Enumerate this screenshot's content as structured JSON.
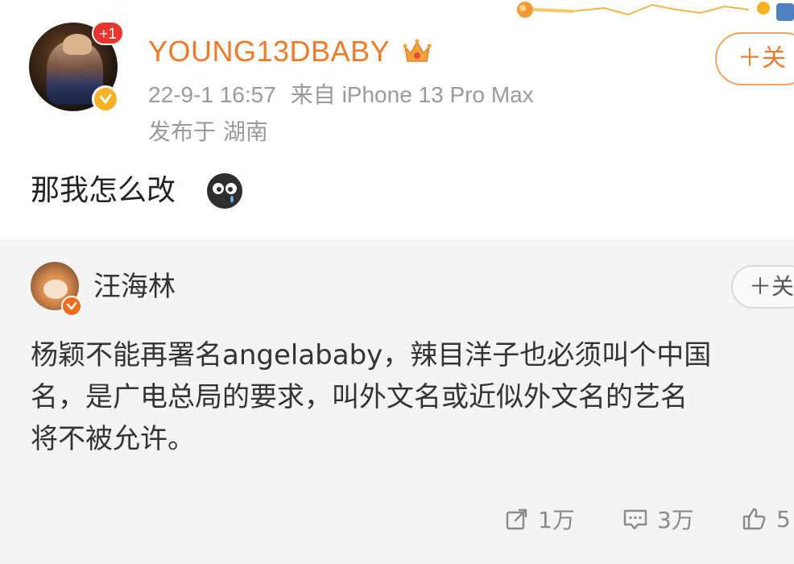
{
  "post": {
    "author": {
      "name": "YOUNG13DBABY",
      "badge": "+1"
    },
    "timestamp": "22-9-1 16:57",
    "source": "来自 iPhone 13 Pro Max",
    "location": "发布于 湖南",
    "follow_label": "＋关",
    "text": "那我怎么改"
  },
  "repost": {
    "author": {
      "name": "汪海林"
    },
    "follow_label": "＋关",
    "text_lines": [
      "杨颖不能再署名angelababy，辣目洋子也必须叫个中国",
      "名，是广电总局的要求，叫外文名或近似外文名的艺名",
      "将不被允许。"
    ],
    "actions": {
      "repost_count": "1万",
      "comment_count": "3万",
      "like_count": "5"
    }
  },
  "colors": {
    "accent_orange": "#ef7a2a",
    "badge_red": "#e8352f",
    "verified_gold": "#f6b223",
    "repost_bg": "#f4f4f4",
    "meta_gray": "#9a9a9a"
  },
  "icons": {
    "top_decoration": "meteor-decoration-icon",
    "crown": "crown-icon",
    "emoji": "crying-emoji-icon",
    "repost": "share-icon",
    "comment": "comment-icon",
    "like": "thumbs-up-icon"
  }
}
